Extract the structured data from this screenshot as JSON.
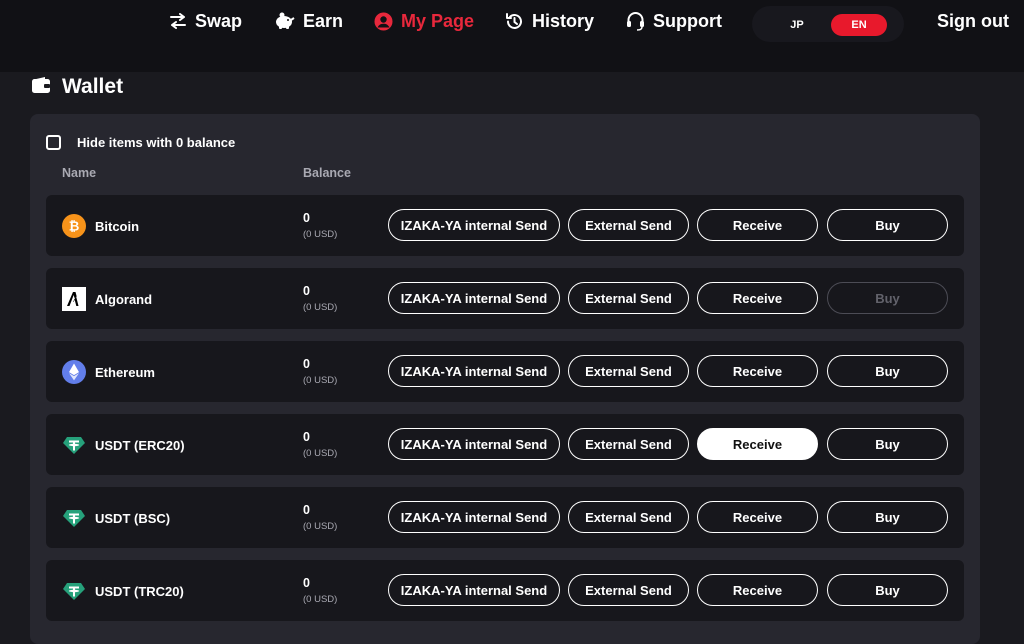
{
  "nav": {
    "items": [
      {
        "label": "Swap",
        "icon": "swap-icon"
      },
      {
        "label": "Earn",
        "icon": "piggy-bank-icon"
      },
      {
        "label": "My Page",
        "icon": "user-circle-icon",
        "active": true
      },
      {
        "label": "History",
        "icon": "history-icon"
      },
      {
        "label": "Support",
        "icon": "headset-icon"
      }
    ],
    "lang_jp": "JP",
    "lang_en": "EN",
    "selected_lang": "EN",
    "sign_out": "Sign out"
  },
  "page": {
    "title": "Wallet",
    "title_icon": "wallet-icon",
    "hide_zero_label": "Hide items with 0 balance",
    "hide_zero_checked": false,
    "col_name": "Name",
    "col_balance": "Balance"
  },
  "buttons": {
    "internal_send": "IZAKA-YA internal Send",
    "external_send": "External Send",
    "receive": "Receive",
    "buy": "Buy"
  },
  "rows": [
    {
      "name": "Bitcoin",
      "icon": "bitcoin-icon",
      "balance": "0",
      "usd": "(0 USD)"
    },
    {
      "name": "Algorand",
      "icon": "algorand-icon",
      "balance": "0",
      "usd": "(0 USD)",
      "buy_disabled": true
    },
    {
      "name": "Ethereum",
      "icon": "ethereum-icon",
      "balance": "0",
      "usd": "(0 USD)"
    },
    {
      "name": "USDT (ERC20)",
      "icon": "tether-icon",
      "balance": "0",
      "usd": "(0 USD)",
      "receive_highlighted": true
    },
    {
      "name": "USDT (BSC)",
      "icon": "tether-icon",
      "balance": "0",
      "usd": "(0 USD)"
    },
    {
      "name": "USDT (TRC20)",
      "icon": "tether-icon",
      "balance": "0",
      "usd": "(0 USD)"
    }
  ],
  "colors": {
    "accent": "#e8283c",
    "background": "#1a1a1f",
    "panel": "#27272f",
    "row": "#17171c",
    "bitcoin": "#f7931a",
    "ethereum": "#627eea",
    "tether": "#26a17b"
  }
}
